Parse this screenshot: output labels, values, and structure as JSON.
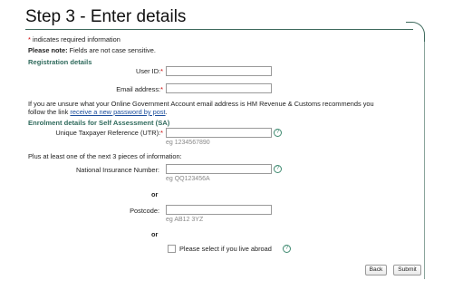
{
  "page": {
    "heading": "Step 3 - Enter details"
  },
  "intro": {
    "required_star": "*",
    "required_text": " indicates required information",
    "note_label": "Please note:",
    "note_text": " Fields are not case sensitive."
  },
  "registration": {
    "title": "Registration details",
    "user_id_label": "User ID:",
    "user_id_value": "",
    "email_label": "Email address:",
    "email_value": ""
  },
  "info": {
    "line1": "If you are unsure what your Online Government Account email address is HM Revenue & Customs recommends you",
    "line2_prefix": "follow the link ",
    "line2_link": "receive a new password by post",
    "line2_suffix": "."
  },
  "enrolment": {
    "title": "Enrolment details for Self Assessment (SA)",
    "utr_label": "Unique Taxpayer Reference (UTR):",
    "utr_value": "",
    "utr_example": "eg 1234567890",
    "plus_text": "Plus at least one of the next 3 pieces of information:",
    "nino_label": "National Insurance Number:",
    "nino_value": "",
    "nino_example": "eg QQ123456A",
    "or_text": "or",
    "postcode_label": "Postcode:",
    "postcode_value": "",
    "postcode_example": "eg AB12 3YZ",
    "abroad_label": "Please select if you live abroad"
  },
  "icons": {
    "help": "?"
  },
  "buttons": {
    "back": "Back",
    "submit": "Submit"
  },
  "colors": {
    "section_title": "#2f6a5c",
    "required_star": "#cc0000",
    "link": "#1a4d9c",
    "help_icon": "#3f8a70"
  }
}
